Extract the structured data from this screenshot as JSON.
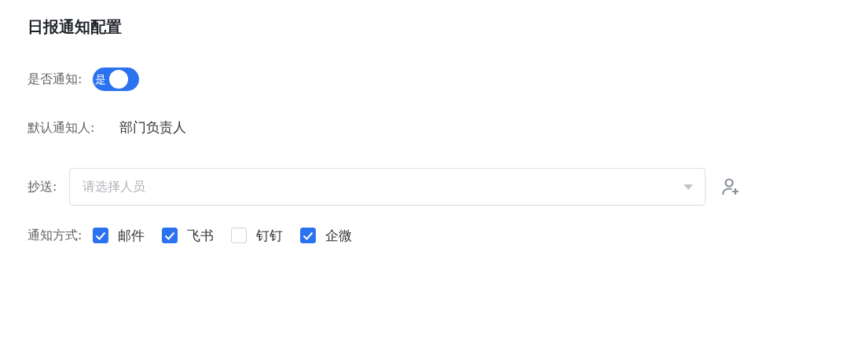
{
  "title": "日报通知配置",
  "notify": {
    "label": "是否通知:",
    "on": true,
    "switch_text": "是"
  },
  "default_recipient": {
    "label": "默认通知人:",
    "value": "部门负责人"
  },
  "cc": {
    "label": "抄送:",
    "placeholder": "请选择人员"
  },
  "methods": {
    "label": "通知方式:",
    "options": [
      {
        "label": "邮件",
        "checked": true
      },
      {
        "label": "飞书",
        "checked": true
      },
      {
        "label": "钉钉",
        "checked": false
      },
      {
        "label": "企微",
        "checked": true
      }
    ]
  }
}
